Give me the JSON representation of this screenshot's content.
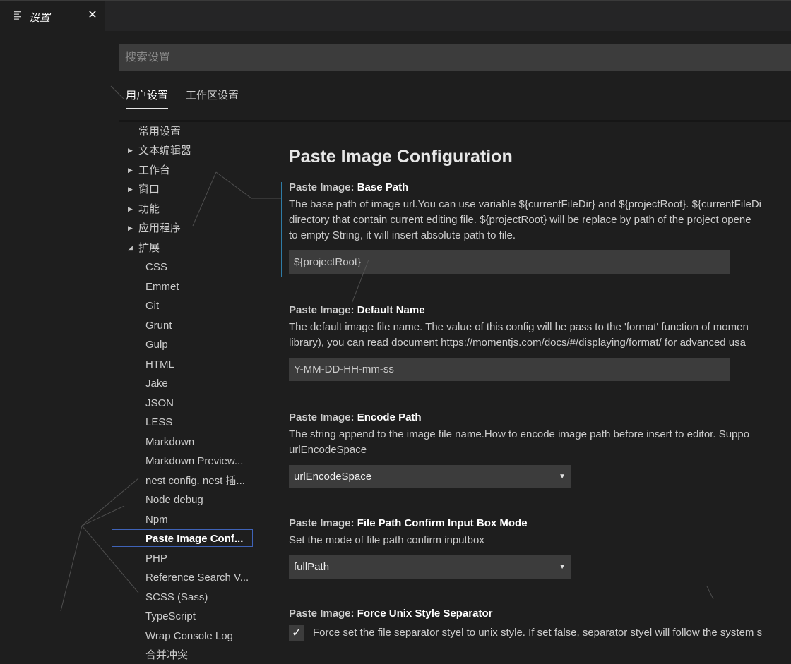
{
  "tab": {
    "title": "设置",
    "close": "✕",
    "icon": "menu-lines-icon"
  },
  "search": {
    "placeholder": "搜索设置"
  },
  "scopes": {
    "user": "用户设置",
    "workspace": "工作区设置"
  },
  "toc": {
    "commonly_used": "常用设置",
    "groups": [
      "文本编辑器",
      "工作台",
      "窗口",
      "功能",
      "应用程序",
      "扩展"
    ],
    "extensions": [
      "CSS",
      "Emmet",
      "Git",
      "Grunt",
      "Gulp",
      "HTML",
      "Jake",
      "JSON",
      "LESS",
      "Markdown",
      "Markdown Preview...",
      "nest config. nest 插...",
      "Node debug",
      "Npm",
      "Paste Image Conf...",
      "PHP",
      "Reference Search V...",
      "SCSS (Sass)",
      "TypeScript",
      "Wrap Console Log"
    ],
    "merge_conflict": "合并冲突",
    "collapsed_arrow": "▶",
    "expanded_arrow": "◢"
  },
  "content": {
    "section_title": "Paste Image Configuration",
    "settings": [
      {
        "category": "Paste Image: ",
        "name": "Base Path",
        "desc": [
          "The base path of image url.You can use variable ${currentFileDir} and ${projectRoot}. ${currentFileDi",
          "directory that contain current editing file. ${projectRoot} will be replace by path of the project opene",
          "to empty String, it will insert absolute path to file."
        ],
        "value": "${projectRoot}"
      },
      {
        "category": "Paste Image: ",
        "name": "Default Name",
        "desc": [
          "The default image file name. The value of this config will be pass to the 'format' function of momen",
          "library), you can read document https://momentjs.com/docs/#/displaying/format/ for advanced usa"
        ],
        "value": "Y-MM-DD-HH-mm-ss"
      },
      {
        "category": "Paste Image: ",
        "name": "Encode Path",
        "desc": [
          "The string append to the image file name.How to encode image path before insert to editor. Suppo",
          "urlEncodeSpace"
        ],
        "value": "urlEncodeSpace"
      },
      {
        "category": "Paste Image: ",
        "name": "File Path Confirm Input Box Mode",
        "desc": [
          "Set the mode of file path confirm inputbox"
        ],
        "value": "fullPath"
      },
      {
        "category": "Paste Image: ",
        "name": "Force Unix Style Separator",
        "checkbox_label": "Force set the file separator styel to unix style. If set false, separator styel will follow the system s",
        "checked": true,
        "check_mark": "✓"
      }
    ],
    "select_caret": "▼"
  },
  "colors": {
    "background": "#1e1e1e",
    "input": "#3c3c3c",
    "focus_border": "#3f63b8",
    "modified_bar": "#2f7ca6"
  }
}
